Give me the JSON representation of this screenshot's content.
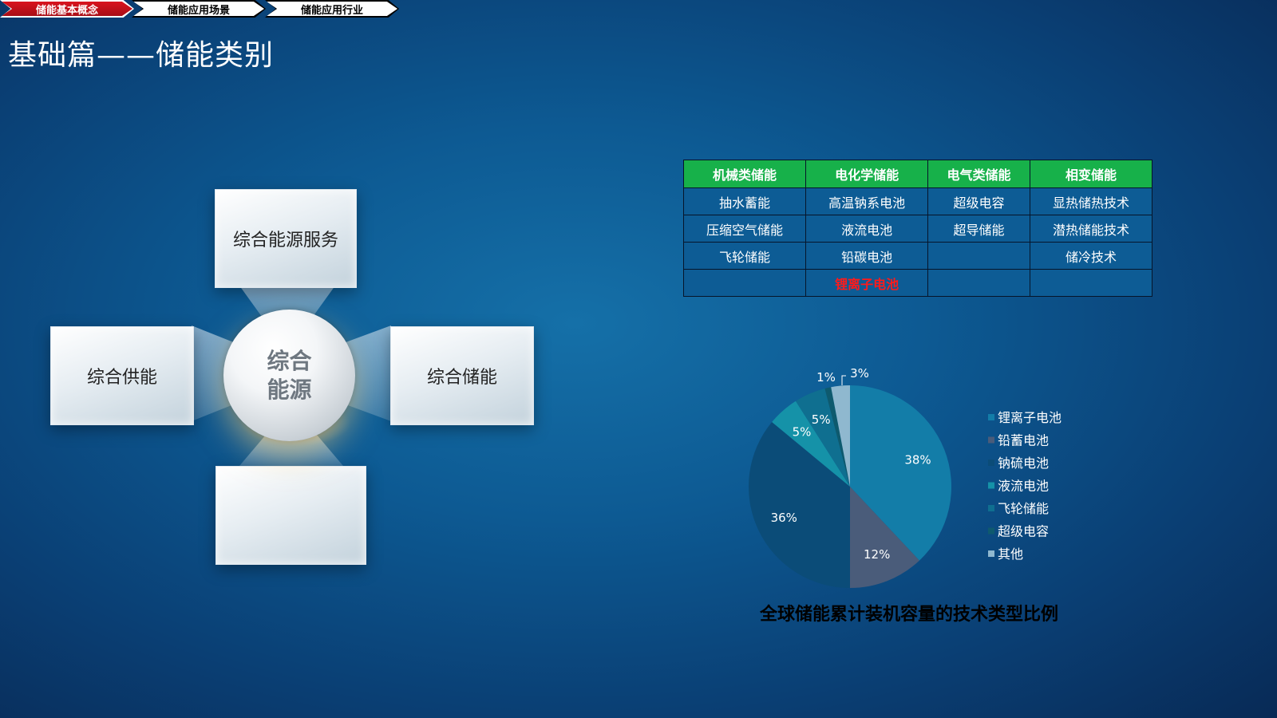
{
  "breadcrumbs": [
    "储能基本概念",
    "储能应用场景",
    "储能应用行业"
  ],
  "page_title": "基础篇——储能类别",
  "diagram": {
    "center": [
      "综合",
      "能源"
    ],
    "top": "综合能源服务",
    "left": "综合供能",
    "right": "综合储能",
    "bottom": ""
  },
  "table": {
    "headers": [
      "机械类储能",
      "电化学储能",
      "电气类储能",
      "相变储能"
    ],
    "rows": [
      [
        "抽水蓄能",
        "高温钠系电池",
        "超级电容",
        "显热储热技术"
      ],
      [
        "压缩空气储能",
        "液流电池",
        "超导储能",
        "潜热储能技术"
      ],
      [
        "飞轮储能",
        "铅碳电池",
        "",
        "储冷技术"
      ],
      [
        "",
        "锂离子电池",
        "",
        ""
      ]
    ],
    "highlight_color": "#ff1a1a"
  },
  "chart_data": {
    "type": "pie",
    "title": "全球储能累计装机容量的技术类型比例",
    "categories": [
      "锂离子电池",
      "铅蓄电池",
      "钠硫电池",
      "液流电池",
      "飞轮储能",
      "超级电容",
      "其他"
    ],
    "values": [
      38,
      12,
      36,
      5,
      5,
      1,
      3
    ],
    "labels": [
      "38%",
      "12%",
      "36%",
      "5%",
      "5%",
      "1%",
      "3%"
    ],
    "colors": [
      "#137da8",
      "#4a5c7a",
      "#0b4c78",
      "#1592a8",
      "#0f6f90",
      "#0e5a6e",
      "#8fb8cf"
    ],
    "legend": "right"
  }
}
